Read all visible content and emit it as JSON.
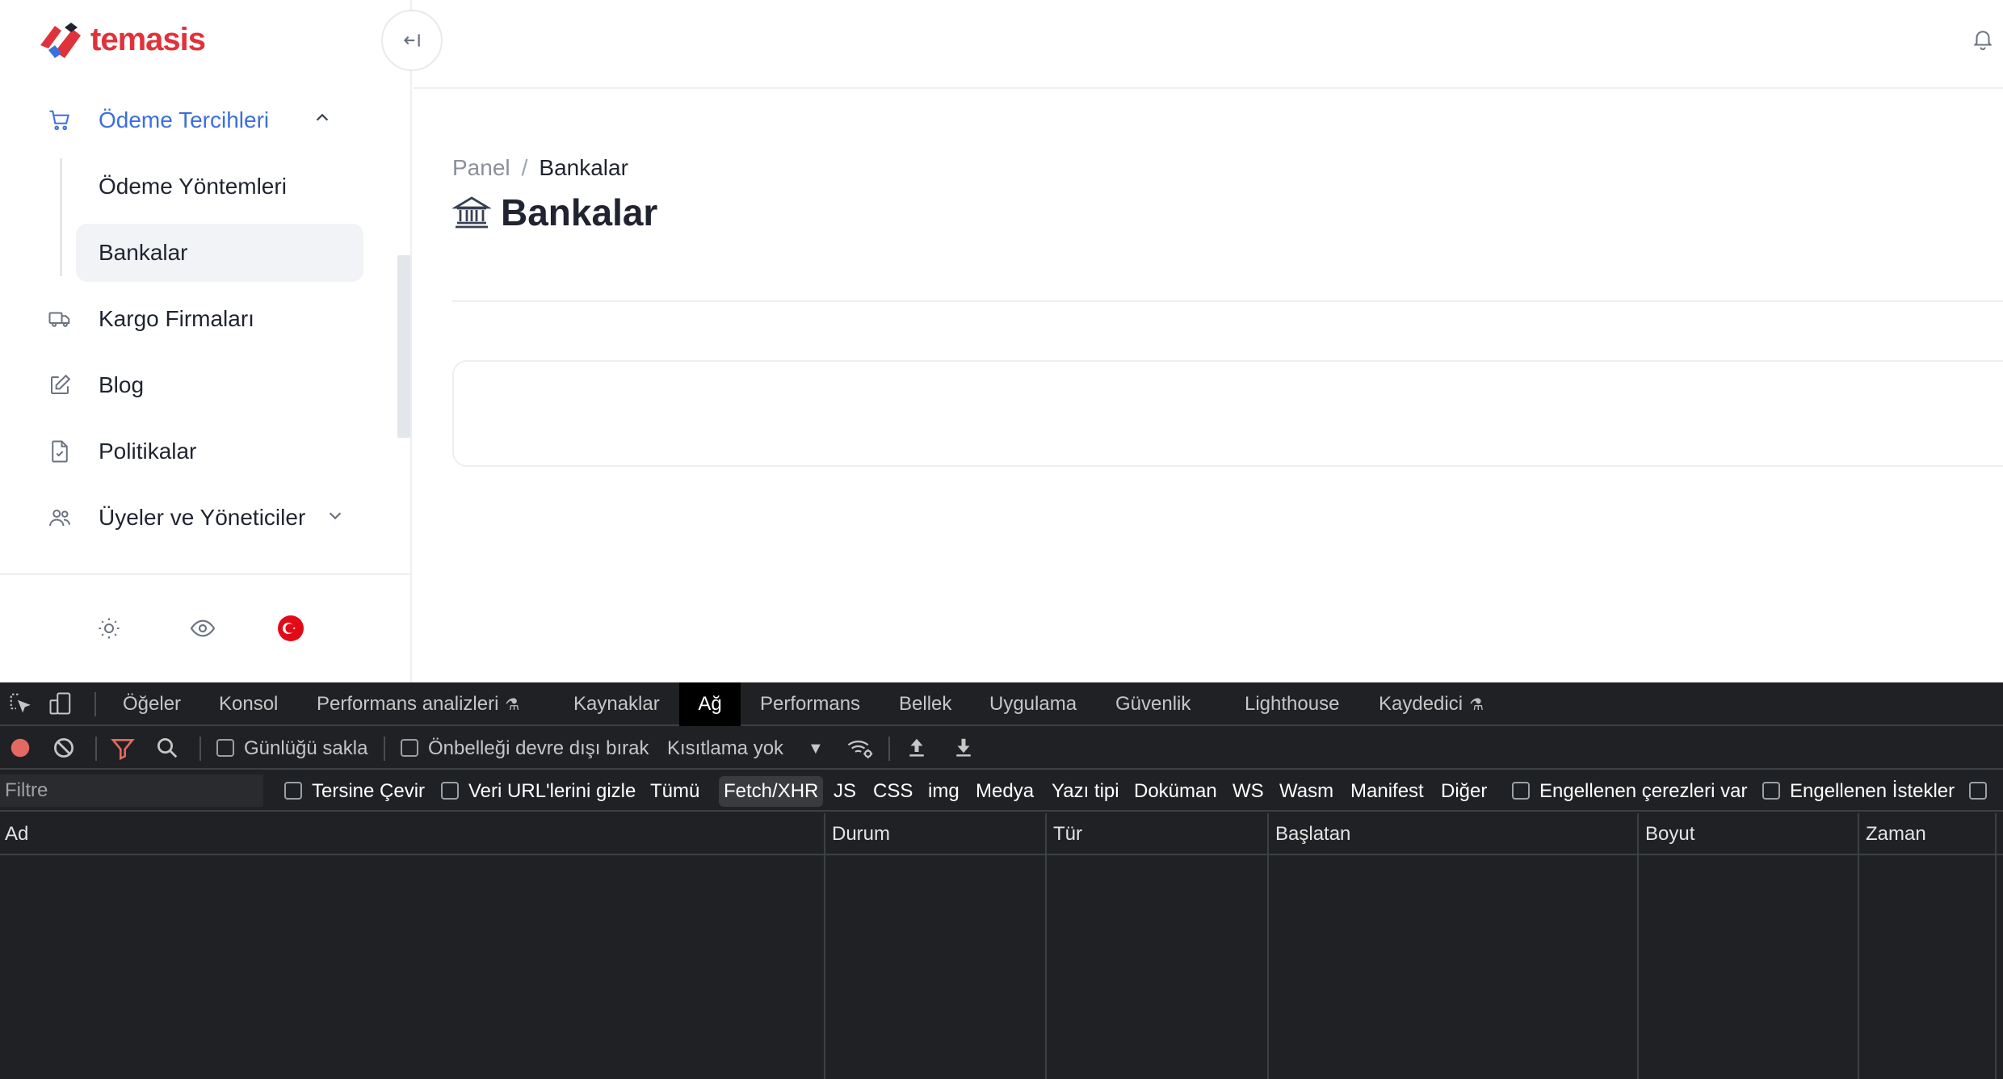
{
  "brand": {
    "name": "temasis",
    "color": "#e0323a"
  },
  "sidebar": {
    "items": [
      {
        "label": "Ödeme Tercihleri",
        "icon": "cart-icon",
        "expanded": true
      },
      {
        "label": "Ödeme Yöntemleri"
      },
      {
        "label": "Bankalar",
        "active": true
      },
      {
        "label": "Kargo Firmaları",
        "icon": "truck-icon"
      },
      {
        "label": "Blog",
        "icon": "edit-icon"
      },
      {
        "label": "Politikalar",
        "icon": "document-check-icon"
      },
      {
        "label": "Üyeler ve Yöneticiler",
        "icon": "users-icon",
        "expanded": false
      }
    ],
    "footer_icons": [
      "sun-icon",
      "eye-icon",
      "turkish-flag-icon"
    ]
  },
  "breadcrumb": {
    "root": "Panel",
    "separator": "/",
    "current": "Bankalar"
  },
  "page": {
    "title": "Bankalar",
    "title_icon": "bank-icon"
  },
  "devtools": {
    "tabs": [
      {
        "label": "Öğeler"
      },
      {
        "label": "Konsol"
      },
      {
        "label": "Performans analizleri",
        "experimental": true
      },
      {
        "label": "Kaynaklar"
      },
      {
        "label": "Ağ",
        "active": true
      },
      {
        "label": "Performans"
      },
      {
        "label": "Bellek"
      },
      {
        "label": "Uygulama"
      },
      {
        "label": "Güvenlik"
      },
      {
        "label": "Lighthouse"
      },
      {
        "label": "Kaydedici",
        "experimental": true
      }
    ],
    "toolbar": {
      "preserve_log": "Günlüğü sakla",
      "disable_cache": "Önbelleği devre dışı bırak",
      "throttling": "Kısıtlama yok"
    },
    "filter": {
      "placeholder": "Filtre",
      "invert": "Tersine Çevir",
      "hide_data_urls": "Veri URL'lerini gizle",
      "types": [
        "Tümü",
        "Fetch/XHR",
        "JS",
        "CSS",
        "img",
        "Medya",
        "Yazı tipi",
        "Doküman",
        "WS",
        "Wasm",
        "Manifest",
        "Diğer"
      ],
      "active_type": "Fetch/XHR",
      "blocked_cookies": "Engellenen çerezleri var",
      "blocked_requests": "Engellenen İstekler"
    },
    "columns": [
      "Ad",
      "Durum",
      "Tür",
      "Başlatan",
      "Boyut",
      "Zaman"
    ],
    "record_color": "#e46962"
  }
}
